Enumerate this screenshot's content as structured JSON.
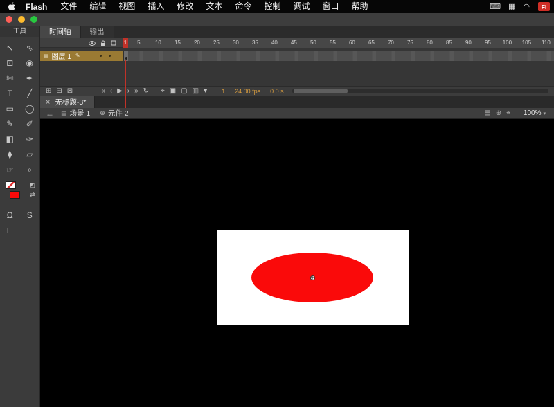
{
  "colors": {
    "ellipse_red": "#fa0a0a",
    "stage_white": "#ffffff",
    "pasteboard_black": "#000000",
    "playhead_red": "#c03229",
    "layer_selection_orange": "#9a7a33",
    "timeline_stat_orange": "#d79c3f",
    "badge_red": "#cf2e26"
  },
  "menubar": {
    "app_name": "Flash",
    "items": [
      "文件",
      "编辑",
      "视图",
      "插入",
      "修改",
      "文本",
      "命令",
      "控制",
      "调试",
      "窗口",
      "帮助"
    ],
    "status_icons": [
      {
        "name": "keyboard-icon",
        "glyph": "⌨"
      },
      {
        "name": "display-icon",
        "glyph": "▦"
      },
      {
        "name": "wifi-icon",
        "glyph": "◠"
      }
    ],
    "fl_badge": "Fl"
  },
  "tools_panel": {
    "title": "工具",
    "tools": [
      {
        "name": "selection-tool",
        "glyph": "↖"
      },
      {
        "name": "subselection-tool",
        "glyph": "⇖"
      },
      {
        "name": "free-transform-tool",
        "glyph": "⊡"
      },
      {
        "name": "gradient-transform-tool",
        "glyph": "◉"
      },
      {
        "name": "lasso-tool",
        "glyph": "✄"
      },
      {
        "name": "pen-tool",
        "glyph": "✒"
      },
      {
        "name": "text-tool",
        "glyph": "T"
      },
      {
        "name": "line-tool",
        "glyph": "╱"
      },
      {
        "name": "rectangle-tool",
        "glyph": "▭"
      },
      {
        "name": "oval-tool",
        "glyph": "◯"
      },
      {
        "name": "pencil-tool",
        "glyph": "✎"
      },
      {
        "name": "brush-tool",
        "glyph": "✐"
      },
      {
        "name": "paint-bucket-tool",
        "glyph": "◧"
      },
      {
        "name": "ink-bottle-tool",
        "glyph": "✑"
      },
      {
        "name": "eyedropper-tool",
        "glyph": "⧫"
      },
      {
        "name": "eraser-tool",
        "glyph": "▱"
      },
      {
        "name": "hand-tool",
        "glyph": "☞"
      },
      {
        "name": "zoom-tool",
        "glyph": "⌕"
      }
    ],
    "stroke_color": "none",
    "fill_color": "#fa0a0a",
    "mini_buttons": [
      {
        "name": "default-colors-button",
        "glyph": "◩"
      },
      {
        "name": "swap-colors-button",
        "glyph": "⇄"
      }
    ],
    "options": [
      {
        "name": "snap-to-objects-button",
        "glyph": "Ω"
      },
      {
        "name": "smooth-button",
        "glyph": "S"
      },
      {
        "name": "straighten-button",
        "glyph": "∟"
      }
    ]
  },
  "timeline": {
    "tabs": [
      {
        "label": "时间轴",
        "active": true
      },
      {
        "label": "输出",
        "active": false
      }
    ],
    "layers": [
      {
        "name": "图层 1",
        "selected": true
      }
    ],
    "ruler_first": "1",
    "ruler_labels": [
      5,
      10,
      15,
      20,
      25,
      30,
      35,
      40,
      45,
      50,
      55,
      60,
      65,
      70,
      75,
      80,
      85,
      90,
      95,
      100,
      105,
      110
    ],
    "current_frame": "1",
    "frame_rate": "24.00 fps",
    "elapsed": "0.0 s",
    "layer_buttons": [
      {
        "name": "new-layer-button",
        "glyph": "⊞"
      },
      {
        "name": "new-folder-button",
        "glyph": "⊟"
      },
      {
        "name": "delete-layer-button",
        "glyph": "⊠"
      }
    ],
    "playback_buttons": [
      {
        "name": "go-to-first-frame-button",
        "glyph": "«"
      },
      {
        "name": "step-back-button",
        "glyph": "‹"
      },
      {
        "name": "play-button",
        "glyph": "▶"
      },
      {
        "name": "step-forward-button",
        "glyph": "›"
      },
      {
        "name": "go-to-last-frame-button",
        "glyph": "»"
      },
      {
        "name": "loop-button",
        "glyph": "↻"
      }
    ],
    "onion_buttons": [
      {
        "name": "center-frame-button",
        "glyph": "⌖"
      },
      {
        "name": "onion-skin-button",
        "glyph": "▣"
      },
      {
        "name": "onion-skin-outlines-button",
        "glyph": "▢"
      },
      {
        "name": "edit-multiple-frames-button",
        "glyph": "▥"
      },
      {
        "name": "modify-markers-button",
        "glyph": "▾"
      }
    ]
  },
  "document": {
    "close_glyph": "×",
    "title": "无标题-3*"
  },
  "edit_bar": {
    "back_glyph": "←",
    "scene": {
      "icon": "▤",
      "label": "场景 1"
    },
    "symbol": {
      "icon": "⊕",
      "label": "元件 2"
    },
    "right_buttons": [
      {
        "name": "edit-scene-button",
        "glyph": "▤"
      },
      {
        "name": "edit-symbol-button",
        "glyph": "⊕"
      },
      {
        "name": "center-stage-button",
        "glyph": "⌖"
      }
    ],
    "zoom": "100%"
  },
  "stage": {
    "shape": "ellipse",
    "registration_point": true
  }
}
